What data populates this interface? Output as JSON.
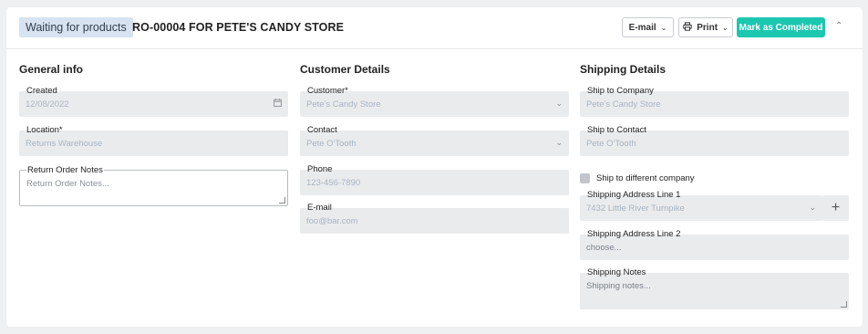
{
  "header": {
    "status": "Waiting for products",
    "title": "RO-00004 FOR PETE'S CANDY STORE",
    "email_label": "E-mail",
    "print_label": "Print",
    "complete_label": "Mark as Completed"
  },
  "general": {
    "title": "General info",
    "created_label": "Created",
    "created_value": "12/08/2022",
    "location_label": "Location*",
    "location_value": "Returns Warehouse",
    "notes_label": "Return Order Notes",
    "notes_placeholder": "Return Order Notes..."
  },
  "customer": {
    "title": "Customer Details",
    "customer_label": "Customer*",
    "customer_value": "Pete's Candy Store",
    "contact_label": "Contact",
    "contact_value": "Pete O'Tooth",
    "phone_label": "Phone",
    "phone_value": "123-456-7890",
    "email_label": "E-mail",
    "email_value": "foo@bar.com"
  },
  "shipping": {
    "title": "Shipping Details",
    "company_label": "Ship to Company",
    "company_value": "Pete's Candy Store",
    "contact_label": "Ship to Contact",
    "contact_value": "Pete O'Tooth",
    "different_label": "Ship to different company",
    "address1_label": "Shipping Address Line 1",
    "address1_value": "7432 Little River Turnpike",
    "address2_label": "Shipping Address Line 2",
    "address2_placeholder": "choose...",
    "notes_label": "Shipping Notes",
    "notes_placeholder": "Shipping notes..."
  }
}
